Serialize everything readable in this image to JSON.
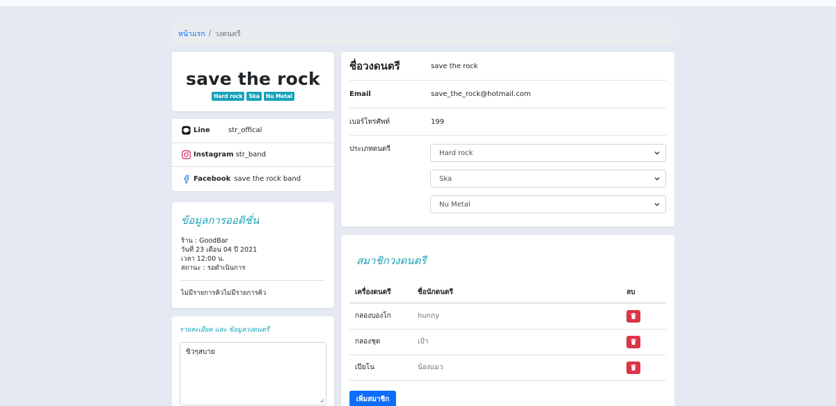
{
  "breadcrumb": {
    "home": "หน้าแรก",
    "separator": "/",
    "current": "วงดนตรี"
  },
  "band": {
    "name": "save the rock",
    "genres": [
      "Hard rock",
      "Ska",
      "Nu Metal"
    ]
  },
  "social": [
    {
      "icon": "line-icon",
      "name": "Line",
      "value": "str_offical"
    },
    {
      "icon": "instagram-icon",
      "name": "Instagram",
      "value": "str_band"
    },
    {
      "icon": "facebook-icon",
      "name": "Facebook",
      "value": "save the rock band"
    }
  ],
  "audition": {
    "title": "ข้อมูลการออดิชั่น",
    "shop": "ร้าน : GoodBar",
    "date": "วันที่ 23 เดือน 04 ปี 2021",
    "time": "เวลา 12:00 น.",
    "status": "สถานะ : รอดำเนินการ",
    "queue": "ไม่มีรายการคิวไม่มีรายการคิว"
  },
  "details": {
    "title": "รายละเอียด และ ข้อมูลวงดนตรี",
    "text": "ขิวๆสบาย"
  },
  "info": {
    "band_label": "ชื่อวงดนตรี",
    "band_value": "save the rock",
    "email_label": "Email",
    "email_value": "save_the_rock@hotmail.com",
    "phone_label": "เบอร์โทรศัพท์",
    "phone_value": "199",
    "genre_label": "ประเภทดนตรี",
    "genre_selects": [
      "Hard rock",
      "Ska",
      "Nu Metal"
    ]
  },
  "members": {
    "title": "สมาชิกวงดนตรี",
    "headers": {
      "instrument": "เครื่องดนตรี",
      "musician": "ชื่อนักดนตรี",
      "delete": "ลบ"
    },
    "rows": [
      {
        "instrument": "กลองบองโก",
        "musician": "hunny"
      },
      {
        "instrument": "กลองชุด",
        "musician": "เป้า"
      },
      {
        "instrument": "เปียโน",
        "musician": "น้องแมว"
      }
    ],
    "add_label": "เพิ่มสมาชิก"
  },
  "colors": {
    "accent": "#17a2b8",
    "primary": "#0d6efd",
    "danger": "#dc3545",
    "bg": "#e4e9f2"
  }
}
